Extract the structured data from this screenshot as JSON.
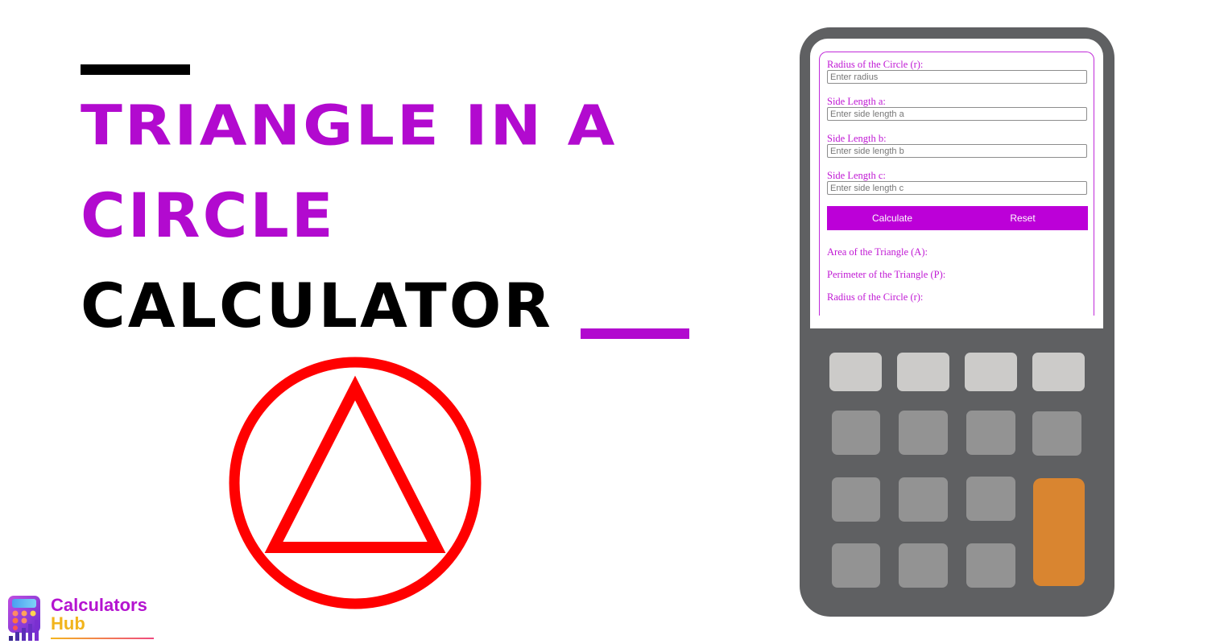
{
  "hero": {
    "title_line1": "Triangle in a",
    "title_line2": "Circle",
    "title_line3": "Calculator",
    "accent_color": "#b20acf",
    "dark_color": "#000000"
  },
  "illustration": {
    "shape": "triangle-inscribed-in-circle",
    "stroke_color": "#ff0000"
  },
  "logo": {
    "word1": "Calculators",
    "word2": "Hub"
  },
  "calculator": {
    "fields": [
      {
        "label": "Radius of the Circle (r):",
        "placeholder": "Enter radius",
        "value": ""
      },
      {
        "label": "Side Length a:",
        "placeholder": "Enter side length a",
        "value": ""
      },
      {
        "label": "Side Length b:",
        "placeholder": "Enter side length b",
        "value": ""
      },
      {
        "label": "Side Length c:",
        "placeholder": "Enter side length c",
        "value": ""
      }
    ],
    "buttons": {
      "calculate": "Calculate",
      "reset": "Reset"
    },
    "results": [
      {
        "label": "Area of the Triangle (A):",
        "value": ""
      },
      {
        "label": "Perimeter of the Triangle (P):",
        "value": ""
      },
      {
        "label": "Radius of the Circle (r):",
        "value": ""
      }
    ],
    "colors": {
      "label": "#c018d4",
      "button_bg": "#bc00d8",
      "body": "#5f6062",
      "key_light": "#cccbc9",
      "key_mid": "#939393",
      "key_orange": "#d98530"
    }
  }
}
